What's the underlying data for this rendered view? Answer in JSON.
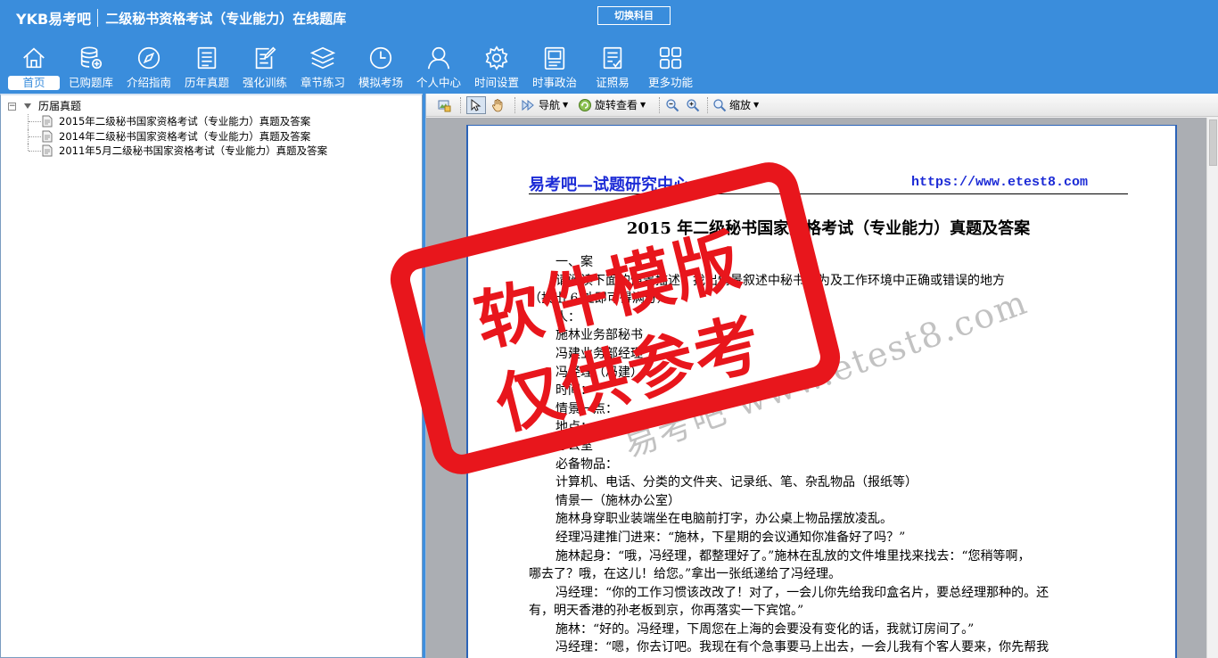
{
  "header": {
    "logo": "YKB易考吧",
    "title": "二级秘书资格考试（专业能力）在线题库",
    "switch_label": "切换科目"
  },
  "nav": [
    {
      "label": "首页",
      "icon": "home-icon"
    },
    {
      "label": "已购题库",
      "icon": "database-icon"
    },
    {
      "label": "介绍指南",
      "icon": "compass-icon"
    },
    {
      "label": "历年真题",
      "icon": "document-list-icon"
    },
    {
      "label": "强化训练",
      "icon": "edit-icon"
    },
    {
      "label": "章节练习",
      "icon": "layers-icon"
    },
    {
      "label": "模拟考场",
      "icon": "clock-icon"
    },
    {
      "label": "个人中心",
      "icon": "user-icon"
    },
    {
      "label": "时间设置",
      "icon": "gear-icon"
    },
    {
      "label": "时事政治",
      "icon": "news-icon"
    },
    {
      "label": "证照易",
      "icon": "certificate-icon"
    },
    {
      "label": "更多功能",
      "icon": "grid-icon"
    }
  ],
  "tree": {
    "root": "历届真题",
    "children": [
      "2015年二级秘书国家资格考试（专业能力）真题及答案",
      "2014年二级秘书国家资格考试（专业能力）真题及答案",
      "2011年5月二级秘书国家资格考试（专业能力）真题及答案"
    ]
  },
  "toolbar": {
    "nav_label": "导航",
    "rotate_label": "旋转查看",
    "zoom_label": "缩放"
  },
  "document": {
    "header_left": "易考吧—试题研究中心",
    "header_right": "https://www.etest8.com",
    "title": "2015 年二级秘书国家资格考试（专业能力）真题及答案",
    "lines": [
      "一、案",
      "请阅读下面的情景描述，找出情景叙述中秘书行为及工作环境中正确或错误的地方",
      "（找出 6 处即可得满分）。",
      "人：",
      "施林业务部秘书",
      "冯建业务部经理",
      "冯经理（冯建）",
      "时间：",
      "情景一点：",
      "地点：",
      "办公室",
      "必备物品：",
      "计算机、电话、分类的文件夹、记录纸、笔、杂乱物品（报纸等）",
      "情景一（施林办公室）",
      "施林身穿职业装端坐在电脑前打字，办公桌上物品摆放凌乱。",
      "经理冯建推门进来：“施林，下星期的会议通知你准备好了吗？”",
      "施林起身：“哦，冯经理，都整理好了。”施林在乱放的文件堆里找来找去：“您稍等啊，",
      "哪去了？哦，在这儿！给您。”拿出一张纸递给了冯经理。",
      "冯经理：“你的工作习惯该改改了！对了，一会儿你先给我印盒名片，要总经理那种的。还",
      "有，明天香港的孙老板到京，你再落实一下宾馆。”",
      "施林：“好的。冯经理，下周您在上海的会要没有变化的话，我就订房间了。”",
      "冯经理：“嗯，你去订吧。我现在有个急事要马上出去，一会儿我有个客人要来，你先帮我"
    ]
  },
  "watermark": {
    "stamp_line1": "软件模版",
    "stamp_line2": "仅供参考",
    "url": "易考吧 www.etest8.com"
  },
  "colors": {
    "header_bg": "#3a8ddc",
    "doc_link": "#1c2bd6",
    "stamp": "#e8161c"
  }
}
